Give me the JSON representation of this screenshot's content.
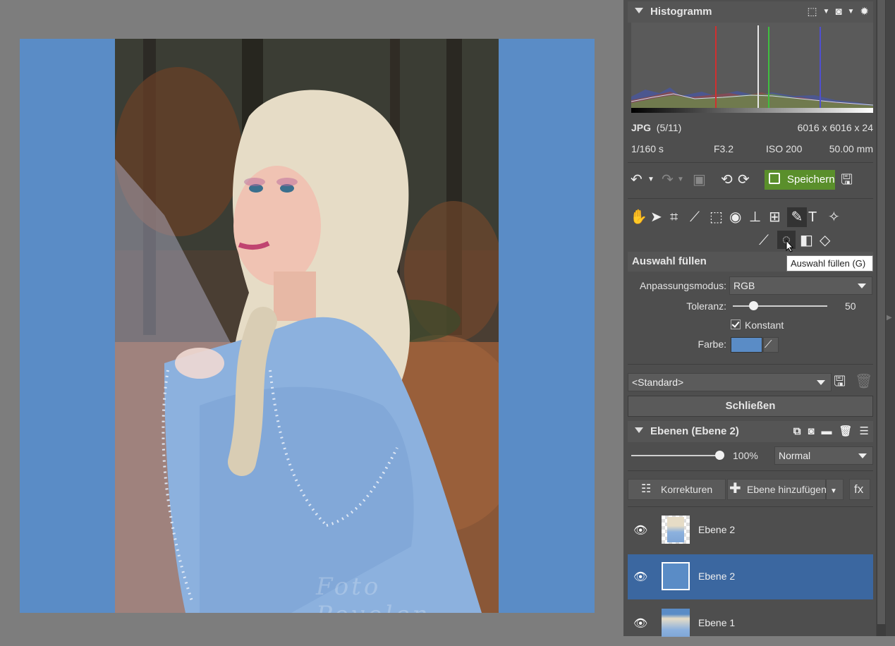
{
  "histogram": {
    "title": "Histogramm",
    "file_type": "JPG",
    "file_index": "(5/11)",
    "dimensions": "6016 x 6016 x 24",
    "shutter": "1/160 s",
    "aperture": "F3.2",
    "iso": "ISO 200",
    "focal": "50.00 mm"
  },
  "toolbar": {
    "save_label": "Speichern"
  },
  "tool": {
    "title": "Auswahl füllen",
    "tooltip": "Auswahl füllen (G)",
    "mode_label": "Anpassungsmodus:",
    "mode_value": "RGB",
    "tolerance_label": "Toleranz:",
    "tolerance_value": "50",
    "tolerance_fraction": 0.22,
    "constant_label": "Konstant",
    "constant_checked": true,
    "color_label": "Farbe:",
    "color_value": "#5a8cc6",
    "preset_value": "<Standard>",
    "close_label": "Schließen"
  },
  "layers": {
    "title": "Ebenen (Ebene 2)",
    "opacity": "100%",
    "opacity_fraction": 1.0,
    "blend_mode": "Normal",
    "corrections_label": "Korrekturen",
    "add_layer_label": "Ebene hinzufügen",
    "fx_label": "fx",
    "items": [
      {
        "name": "Ebene 2",
        "visible": true,
        "selected": false
      },
      {
        "name": "Ebene 2",
        "visible": true,
        "selected": true
      },
      {
        "name": "Ebene 1",
        "visible": true,
        "selected": false
      }
    ]
  },
  "canvas": {
    "fill_color": "#5a8cc6",
    "watermark": "Foto Povolen"
  },
  "colors": {
    "accent_green": "#5a8f2b",
    "selection_blue": "#3b67a0"
  }
}
